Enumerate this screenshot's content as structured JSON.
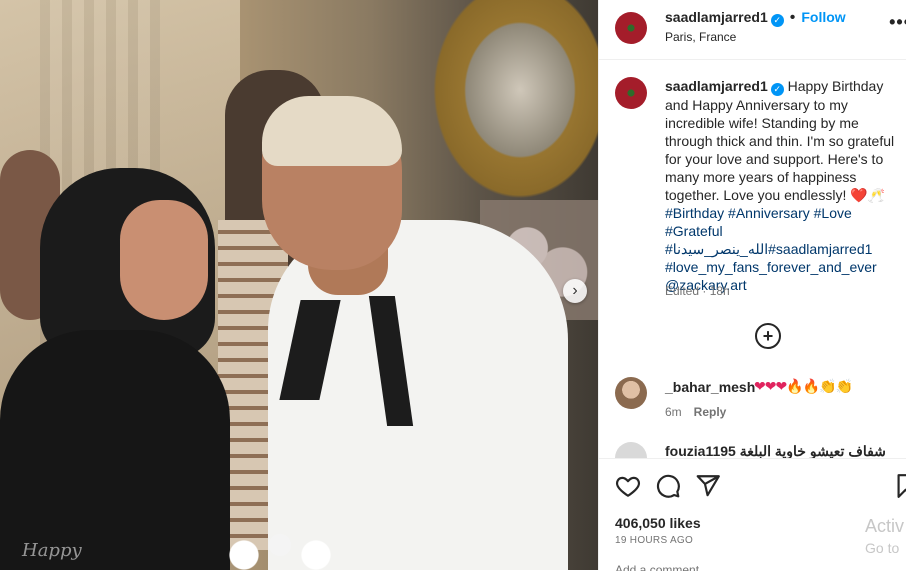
{
  "post": {
    "username": "saadlamjarred1",
    "verified_mark": "✓",
    "separator": "•",
    "follow_label": "Follow",
    "location": "Paris, France",
    "more_label": "•••",
    "photo_watermark": "Happy",
    "next_label": "›"
  },
  "caption": {
    "username": "saadlamjarred1",
    "text_1": "Happy Birthday and Happy Anniversary to my incredible wife! Standing by me through thick and thin. I'm so grateful for your love and support. Here's to many more years of happiness together. Love you endlessly! ",
    "emojis_1": "❤️🥂",
    "tag_birthday": "#Birthday",
    "tag_anniversary": "#Anniversary",
    "tag_love": "#Love",
    "tag_grateful": "#Grateful",
    "tag_arabic": "#الله_ينصر_سيدنا",
    "tag_saad": "#saadlamjarred1",
    "tag_fans": "#love_my_fans_forever_and_ever",
    "mention": "@zackary.art",
    "edited": "Edited · 18h"
  },
  "load_more_label": "+",
  "comments": [
    {
      "username": "_bahar_mesh",
      "text": "❤❤❤🔥🔥👏👏",
      "age": "6m",
      "reply_label": "Reply"
    },
    {
      "partial_text": "fouzia1195 شفاف تعيشو خاوية البلغة"
    }
  ],
  "actions": {
    "likes": "406,050 likes",
    "timestamp": "19 HOURS AGO",
    "activate_line1": "Activ",
    "activate_line2": "Go to",
    "add_comment_placeholder": "Add a comment..."
  },
  "colors": {
    "accent": "#0095f6",
    "hashtag": "#00376b",
    "secondary": "#737373",
    "border": "#efefef"
  }
}
